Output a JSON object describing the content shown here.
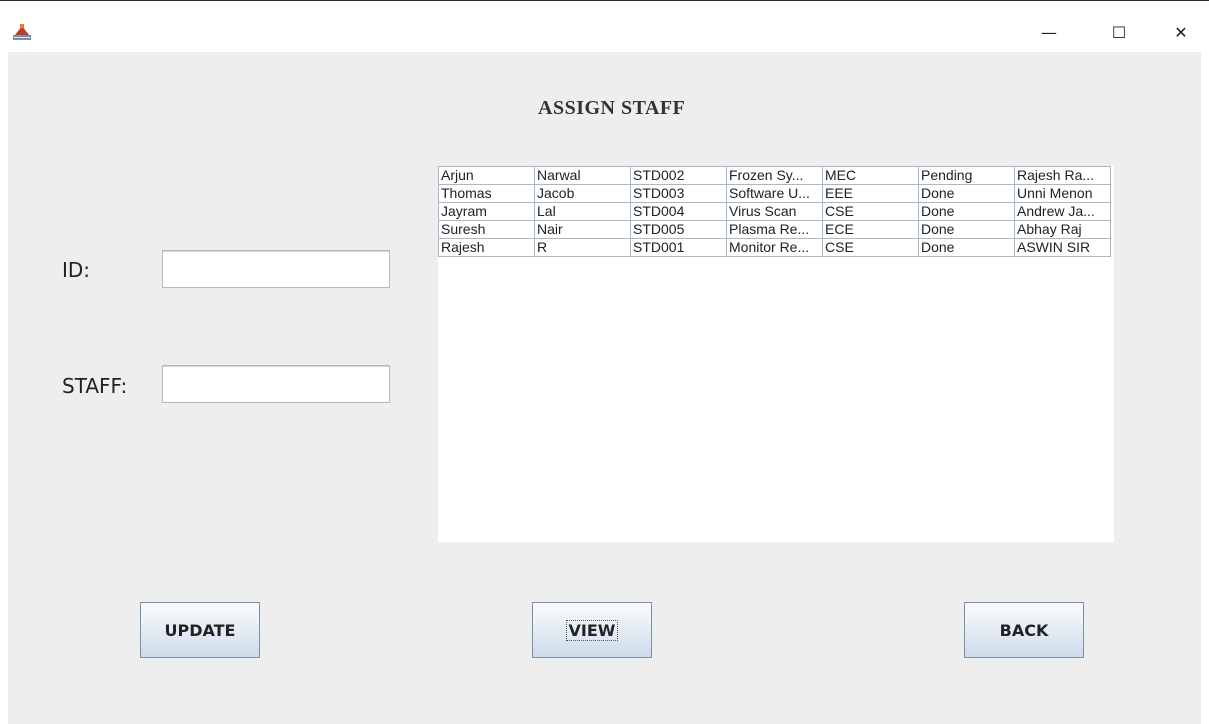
{
  "window": {
    "minimize_glyph": "—",
    "maximize_glyph": "☐",
    "close_glyph": "✕"
  },
  "page": {
    "title": "ASSIGN STAFF"
  },
  "form": {
    "id_label": "ID:",
    "id_value": "",
    "staff_label": "STAFF:",
    "staff_value": ""
  },
  "table": {
    "rows": [
      [
        "Arjun",
        "Narwal",
        "STD002",
        "Frozen Sy...",
        "MEC",
        "Pending",
        "Rajesh Ra..."
      ],
      [
        "Thomas",
        "Jacob",
        "STD003",
        "Software U...",
        "EEE",
        "Done",
        "Unni Menon"
      ],
      [
        "Jayram",
        "Lal",
        "STD004",
        "Virus Scan",
        "CSE",
        "Done",
        "Andrew Ja..."
      ],
      [
        "Suresh",
        "Nair",
        "STD005",
        "Plasma Re...",
        "ECE",
        "Done",
        "Abhay Raj"
      ],
      [
        "Rajesh",
        "R",
        "STD001",
        "Monitor Re...",
        "CSE",
        "Done",
        "ASWIN SIR"
      ]
    ]
  },
  "buttons": {
    "update": "UPDATE",
    "view": "VIEW",
    "back": "BACK"
  }
}
